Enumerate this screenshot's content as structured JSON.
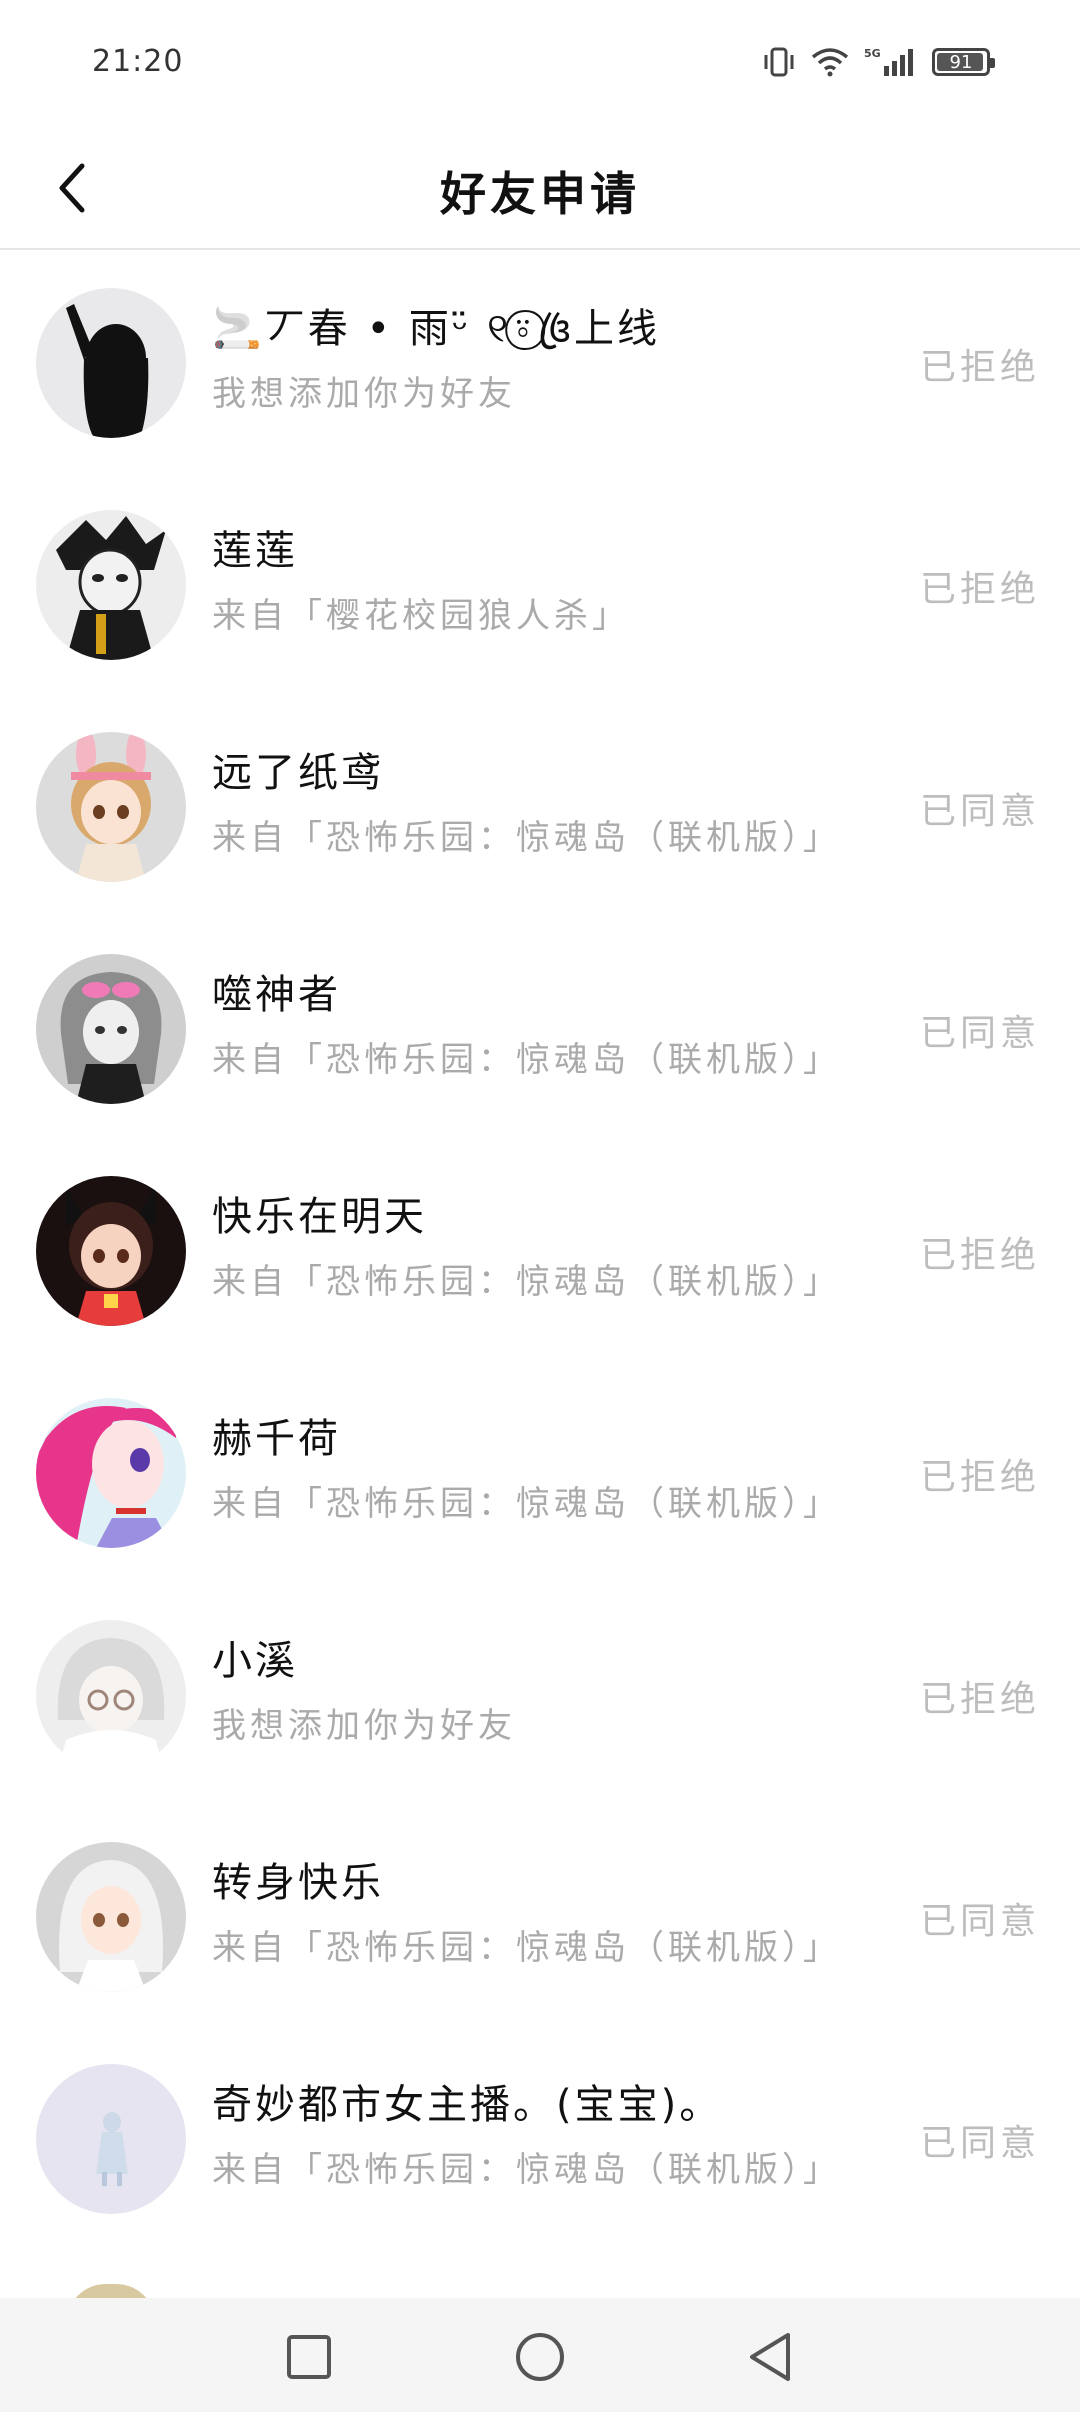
{
  "status_bar": {
    "time": "21:20",
    "battery": "91"
  },
  "header": {
    "title": "好友申请"
  },
  "requests": [
    {
      "name": "🚬丆春 • 雨ᵕ̈ ୧⍤⃝꧔ꦿ上线",
      "subtitle": "我想添加你为好友",
      "status": "已拒绝",
      "avatar": "avatar-silhouette"
    },
    {
      "name": "莲莲",
      "subtitle": "来自「樱花校园狼人杀」",
      "status": "已拒绝",
      "avatar": "avatar-masked-boy"
    },
    {
      "name": "远了纸鸢",
      "subtitle": "来自「恐怖乐园：惊魂岛（联机版）」",
      "status": "已同意",
      "avatar": "avatar-bunny-girl"
    },
    {
      "name": "噬神者",
      "subtitle": "来自「恐怖乐园：惊魂岛（联机版）」",
      "status": "已同意",
      "avatar": "avatar-mask-glasses"
    },
    {
      "name": "快乐在明天",
      "subtitle": "来自「恐怖乐园：惊魂岛（联机版）」",
      "status": "已拒绝",
      "avatar": "avatar-cat-ears"
    },
    {
      "name": "赫千荷",
      "subtitle": "来自「恐怖乐园：惊魂岛（联机版）」",
      "status": "已拒绝",
      "avatar": "avatar-pink-hair"
    },
    {
      "name": "小溪",
      "subtitle": "我想添加你为好友",
      "status": "已拒绝",
      "avatar": "avatar-white-hair-glasses"
    },
    {
      "name": "转身快乐",
      "subtitle": "来自「恐怖乐园：惊魂岛（联机版）」",
      "status": "已同意",
      "avatar": "avatar-silver-hair"
    },
    {
      "name": "奇妙都市女主播。(宝宝)。",
      "subtitle": "来自「恐怖乐园：惊魂岛（联机版）」",
      "status": "已同意",
      "avatar": "avatar-small-figure"
    }
  ],
  "nav": {
    "recent": "square-icon",
    "home": "circle-icon",
    "back": "triangle-back-icon"
  }
}
